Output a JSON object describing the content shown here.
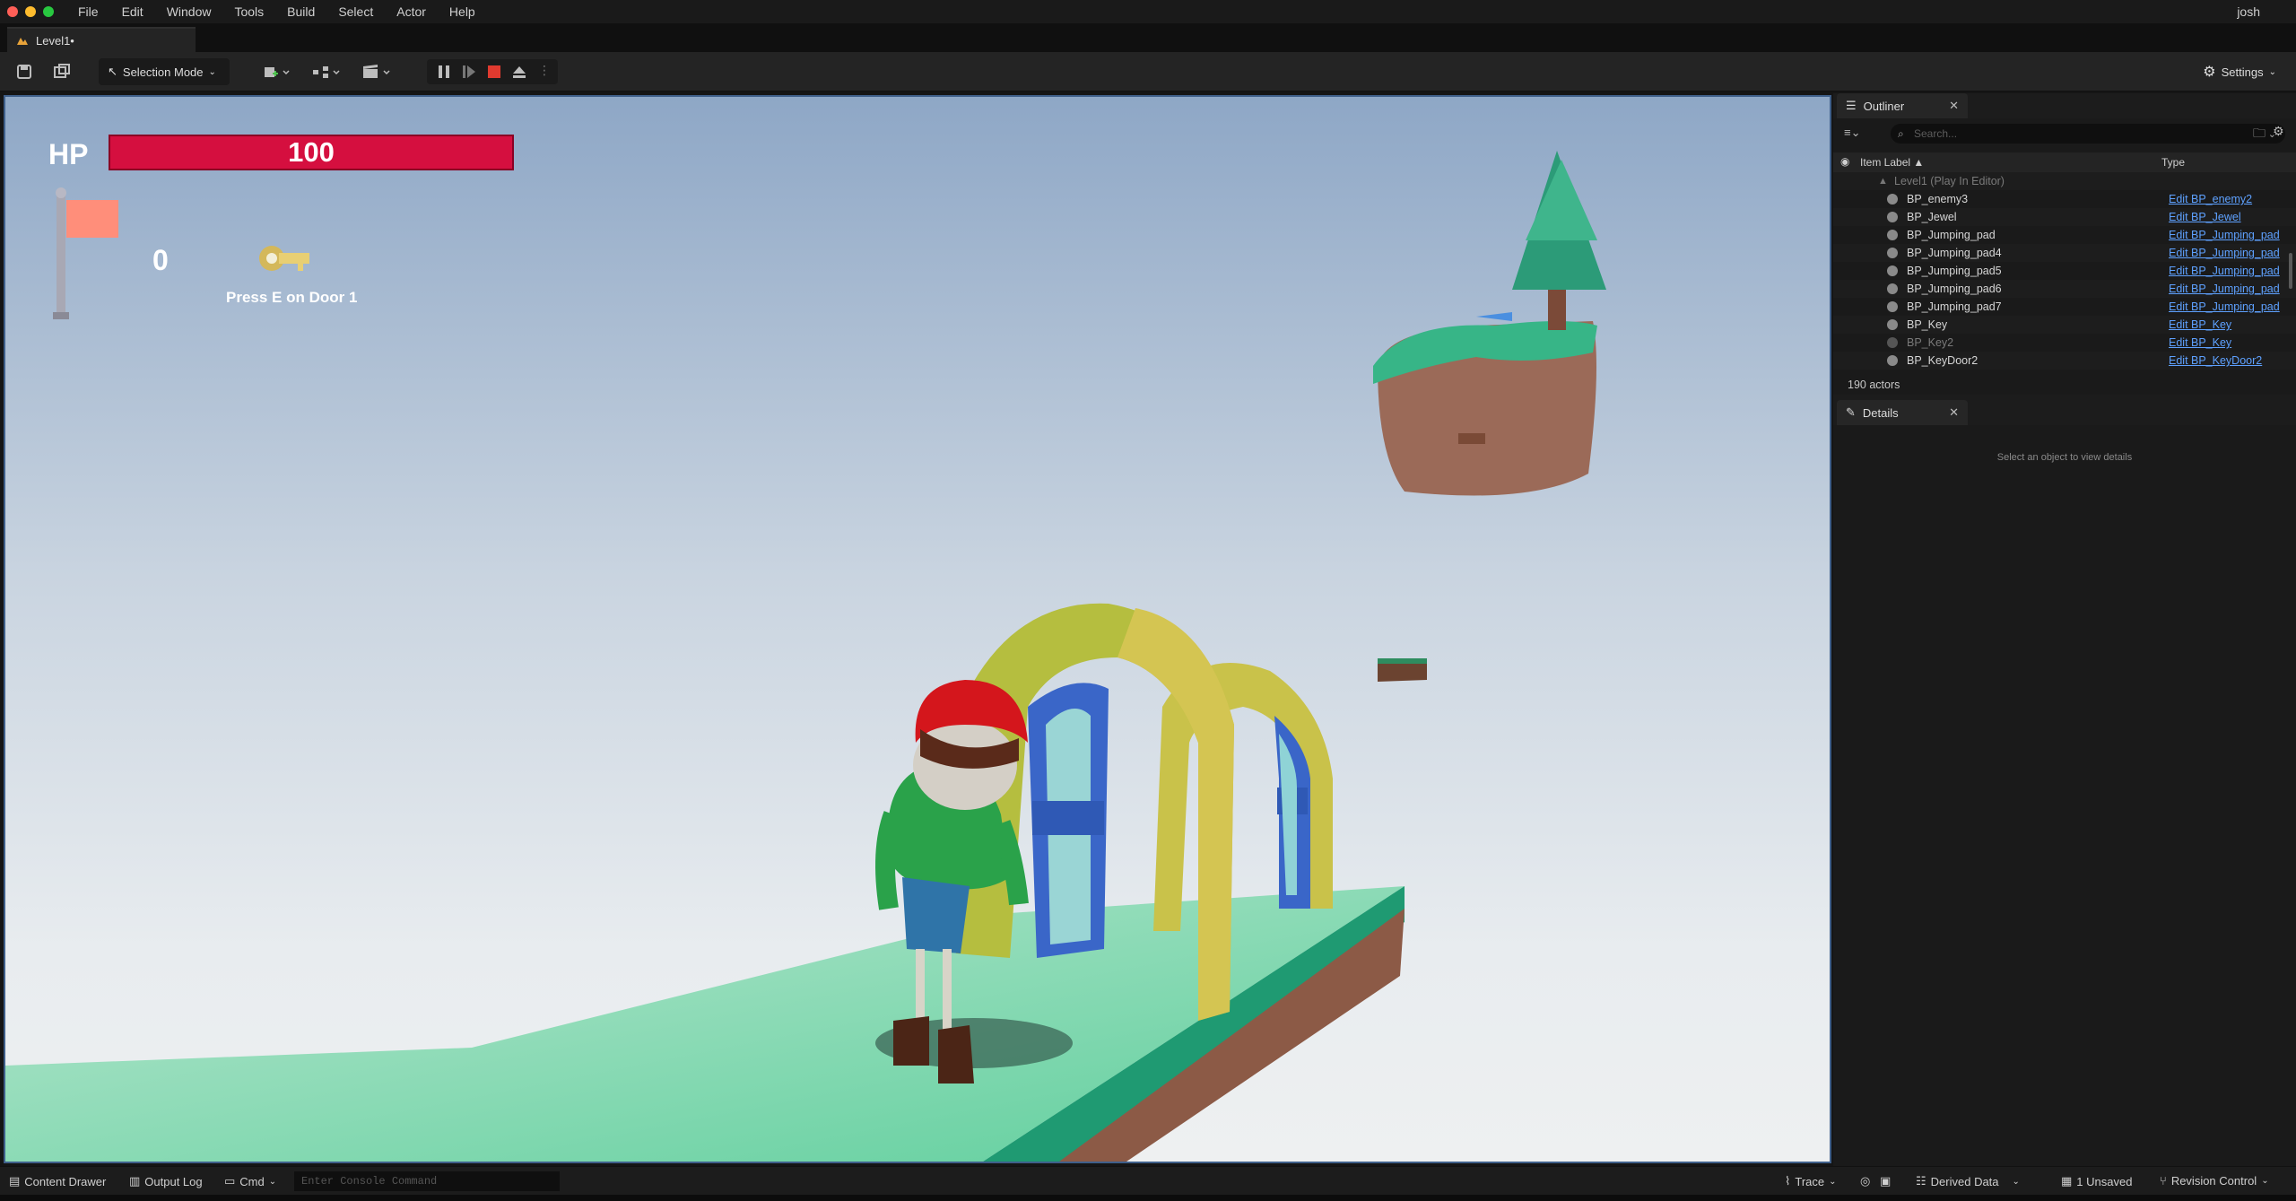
{
  "menu": {
    "items": [
      "File",
      "Edit",
      "Window",
      "Tools",
      "Build",
      "Select",
      "Actor",
      "Help"
    ],
    "user": "josh"
  },
  "tab": {
    "title": "Level1•"
  },
  "toolbar": {
    "selection_mode": "Selection Mode",
    "settings": "Settings"
  },
  "hud": {
    "hp_label": "HP",
    "hp_value": "100",
    "hp_fraction": 1.0,
    "flag_count": "0",
    "prompt": "Press E on Door 1"
  },
  "outliner": {
    "tab_label": "Outliner",
    "search_placeholder": "Search...",
    "col_item_label": "Item Label ▲",
    "col_type": "Type",
    "root_label": "Level1 (Play In Editor)",
    "rows": [
      {
        "label": "BP_enemy3",
        "type": "Edit BP_enemy2"
      },
      {
        "label": "BP_Jewel",
        "type": "Edit BP_Jewel"
      },
      {
        "label": "BP_Jumping_pad",
        "type": "Edit BP_Jumping_pad"
      },
      {
        "label": "BP_Jumping_pad4",
        "type": "Edit BP_Jumping_pad"
      },
      {
        "label": "BP_Jumping_pad5",
        "type": "Edit BP_Jumping_pad"
      },
      {
        "label": "BP_Jumping_pad6",
        "type": "Edit BP_Jumping_pad"
      },
      {
        "label": "BP_Jumping_pad7",
        "type": "Edit BP_Jumping_pad"
      },
      {
        "label": "BP_Key",
        "type": "Edit BP_Key"
      },
      {
        "label": "BP_Key2",
        "type": "Edit BP_Key"
      },
      {
        "label": "BP_KeyDoor2",
        "type": "Edit BP_KeyDoor2"
      }
    ],
    "actor_count": "190 actors"
  },
  "details": {
    "tab_label": "Details",
    "empty_text": "Select an object to view details"
  },
  "statusbar": {
    "content_drawer": "Content Drawer",
    "output_log": "Output Log",
    "cmd": "Cmd",
    "console_placeholder": "Enter Console Command",
    "trace": "Trace",
    "derived_data": "Derived Data",
    "unsaved": "1 Unsaved",
    "revision_control": "Revision Control"
  },
  "colors": {
    "hp_bar": "#d50f3f",
    "link": "#5ea1ff",
    "accent_blue": "#3f5f8a"
  }
}
